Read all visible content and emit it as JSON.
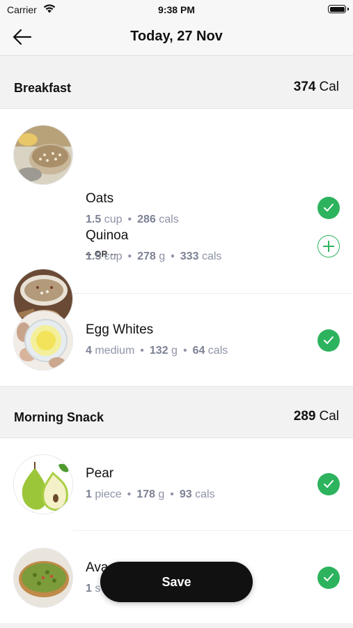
{
  "status_bar": {
    "carrier": "Carrier",
    "time": "9:38 PM"
  },
  "nav": {
    "title": "Today, 27 Nov"
  },
  "sections": [
    {
      "title": "Breakfast",
      "calories": "374",
      "cal_unit": "Cal",
      "or_label": "-- OR --",
      "items": [
        {
          "name": "Oats",
          "qty": "1.5",
          "qty_unit": "cup",
          "cals": "286",
          "cals_unit": "cals",
          "state": "checked",
          "icon": "oats-photo"
        },
        {
          "name": "Quinoa",
          "qty": "1.5",
          "qty_unit": "cup",
          "weight": "278",
          "weight_unit": "g",
          "cals": "333",
          "cals_unit": "cals",
          "state": "add",
          "icon": "quinoa-photo"
        },
        {
          "name": "Egg Whites",
          "qty": "4",
          "qty_unit": "medium",
          "weight": "132",
          "weight_unit": "g",
          "cals": "64",
          "cals_unit": "cals",
          "state": "checked",
          "icon": "egg-whites-photo"
        }
      ]
    },
    {
      "title": "Morning Snack",
      "calories": "289",
      "cal_unit": "Cal",
      "items": [
        {
          "name": "Pear",
          "qty": "1",
          "qty_unit": "piece",
          "weight": "178",
          "weight_unit": "g",
          "cals": "93",
          "cals_unit": "cals",
          "state": "checked",
          "icon": "pear-photo"
        },
        {
          "name": "Ava",
          "qty": "1",
          "qty_unit": "s",
          "state": "checked",
          "icon": "avocado-toast-photo"
        }
      ]
    }
  ],
  "save_label": "Save",
  "colors": {
    "accent_green": "#2db35d",
    "meta_gray": "#8e93a6",
    "section_bg": "#f2f2f3",
    "save_bg": "#111111"
  }
}
